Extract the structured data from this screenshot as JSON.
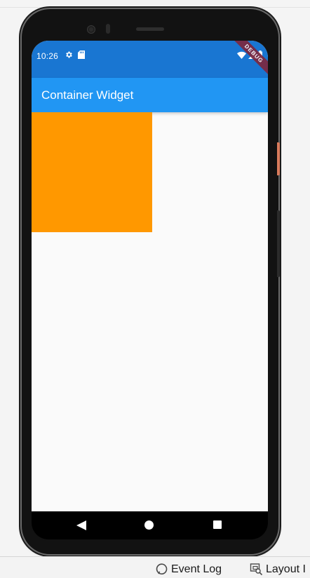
{
  "status_bar": {
    "time": "10:26",
    "icons": [
      "settings-gear-icon",
      "sd-card-icon",
      "wifi-icon",
      "cell-signal-icon",
      "battery-icon"
    ],
    "color": "#1976d2"
  },
  "debug_banner": {
    "label": "DEBUG"
  },
  "app_bar": {
    "title": "Container Widget",
    "color": "#2196f3"
  },
  "container": {
    "color": "#ff9800"
  },
  "navigation": {
    "icons": [
      "back-icon",
      "home-icon",
      "recent-apps-icon"
    ]
  },
  "ide_toolbar": {
    "event_log_label": "Event Log",
    "layout_inspector_label": "Layout I"
  }
}
